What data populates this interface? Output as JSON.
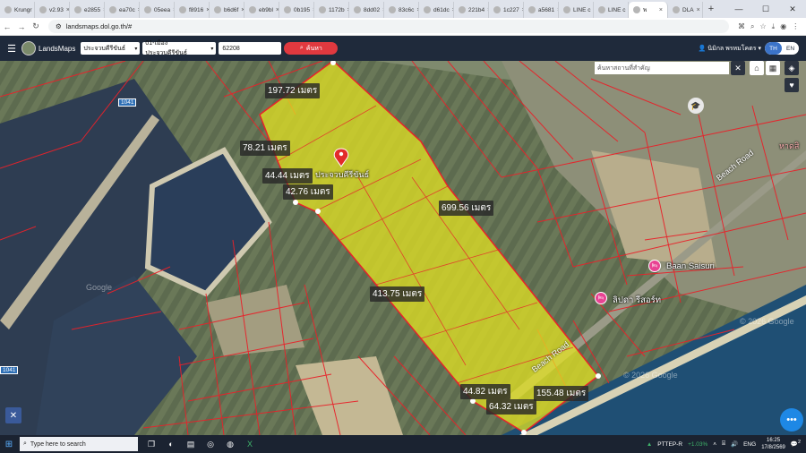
{
  "browser": {
    "tabs": [
      {
        "label": "Krungr"
      },
      {
        "label": "v2.93"
      },
      {
        "label": "e2855"
      },
      {
        "label": "ea70c"
      },
      {
        "label": "05eea"
      },
      {
        "label": "f8916"
      },
      {
        "label": "b6d6f"
      },
      {
        "label": "eb9bl"
      },
      {
        "label": "0b195"
      },
      {
        "label": "1172b"
      },
      {
        "label": "8dd02"
      },
      {
        "label": "83c6c"
      },
      {
        "label": "d61dc"
      },
      {
        "label": "221b4"
      },
      {
        "label": "1c227"
      },
      {
        "label": "a5681"
      },
      {
        "label": "LINE c"
      },
      {
        "label": "LINE c"
      },
      {
        "label": "พ"
      },
      {
        "label": "DLA"
      }
    ],
    "active_tab_index": 18,
    "new_tab": "+",
    "url": "landsmaps.dol.go.th/#"
  },
  "app": {
    "name": "LandsMaps",
    "province": "ประจวบคีรีขันธ์",
    "district": "01-เมืองประจวบคีรีขันธ์",
    "parcel_number": "62208",
    "search_label": "ค้นหา",
    "user_name": "นิมิกล พรหมโคตร",
    "lang_th": "TH",
    "lang_en": "EN"
  },
  "map": {
    "place_search_placeholder": "ค้นหาสถานที่สำคัญ",
    "parcel_label": "ประจวบคีรีขันธ์",
    "measurements": [
      {
        "text": "197.72 เมตร"
      },
      {
        "text": "78.21 เมตร"
      },
      {
        "text": "44.44 เมตร"
      },
      {
        "text": "42.76 เมตร"
      },
      {
        "text": "699.56 เมตร"
      },
      {
        "text": "413.75 เมตร"
      },
      {
        "text": "44.82 เมตร"
      },
      {
        "text": "155.48 เมตร"
      },
      {
        "text": "64.32 เมตร"
      }
    ],
    "road_labels": [
      {
        "text": "Beach Road"
      },
      {
        "text": "Beach Road"
      }
    ],
    "places": [
      {
        "name": "Baan Saisuri"
      },
      {
        "name": "ลิปดา รีสอร์ท"
      }
    ],
    "place_edge": "หาดสิ",
    "highway_shields": [
      "1041",
      "1041"
    ],
    "watermarks": [
      "Google",
      "© 2026 Google",
      "© 2026 Google"
    ],
    "colors": {
      "parcel_fill": "#e8e620",
      "boundary": "#e8222a",
      "water": "#2c3e5c",
      "sea": "#1f4f74"
    }
  },
  "taskbar": {
    "search_placeholder": "Type here to search",
    "stock_name": "PTTEP-R",
    "stock_change": "+1.03%",
    "language": "ENG",
    "time": "16:25",
    "date": "17/8/2569",
    "notif_count": "2"
  }
}
